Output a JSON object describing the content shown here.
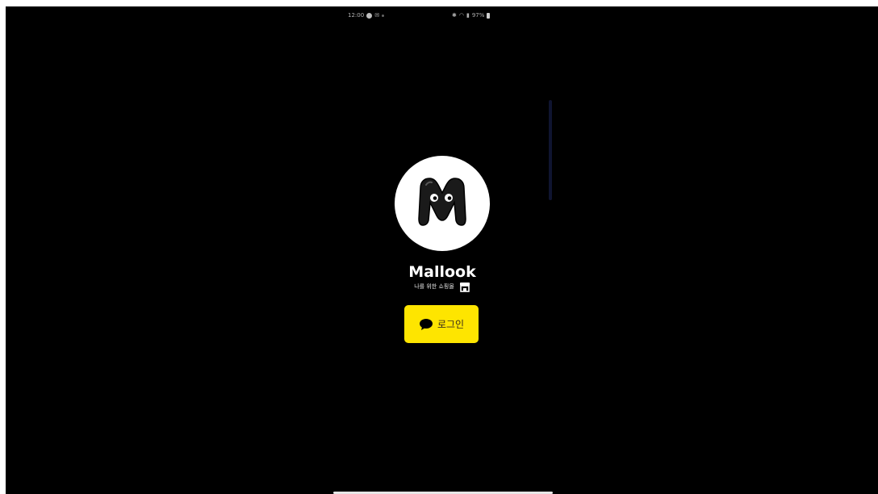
{
  "status_bar": {
    "time": "12:00",
    "right_text": "97%"
  },
  "app": {
    "name": "Mallook",
    "tagline": "나를 위한 쇼핑몰"
  },
  "login_button": {
    "label": "로그인",
    "color": "#fee500"
  },
  "icons": {
    "logo": "m-monster-logo-icon",
    "store": "store-icon",
    "chat": "speech-bubble-icon"
  },
  "colors": {
    "background": "#000000",
    "logo_bg": "#ffffff",
    "kakao_yellow": "#fee500"
  }
}
